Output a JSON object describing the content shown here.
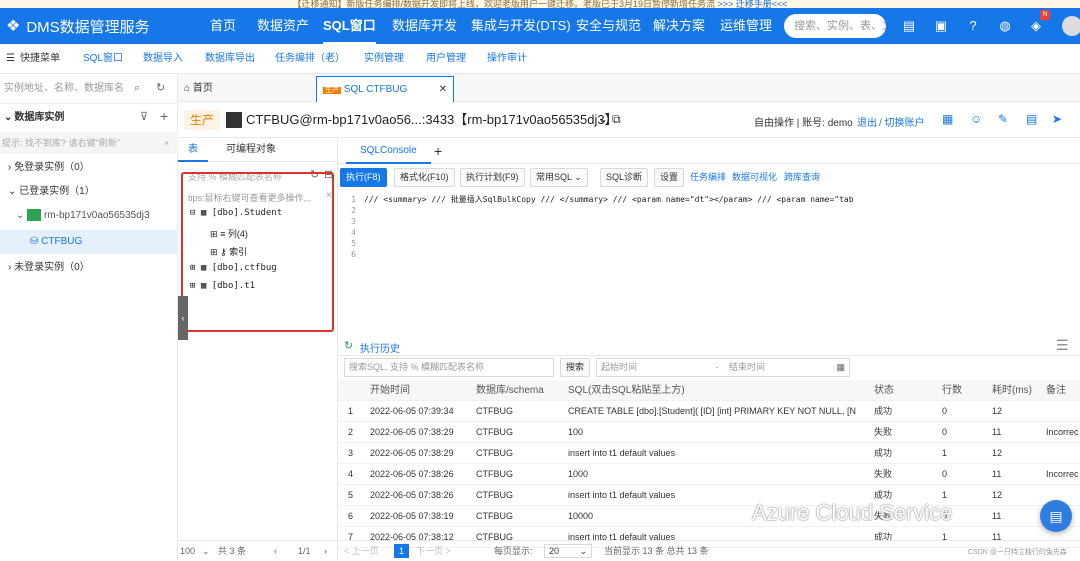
{
  "notice": {
    "text": "【迁移通知】新版任务编排/数据开发即将上线，欢迎老版用户一键迁移。老版已于3月19日暂停新增任务流",
    "link": ">>> 迁移手册<<<"
  },
  "brand": {
    "name": "DMS数据管理服务"
  },
  "topnav": {
    "items": [
      "首页",
      "数据资产",
      "SQL窗口",
      "数据库开发",
      "集成与开发(DTS)",
      "安全与规范",
      "解决方案",
      "运维管理"
    ],
    "search_placeholder": "搜索、实例、表、文",
    "badge": "N"
  },
  "subnav": {
    "items": [
      "快捷菜单",
      "SQL窗口",
      "数据导入",
      "数据库导出",
      "任务编排（老）",
      "实例管理",
      "用户管理",
      "操作审计"
    ]
  },
  "left": {
    "search_placeholder": "实例地址、名称、数据库名",
    "section": "数据库实例",
    "hint": "提示: 找不到库? 请右键\"刷新\"",
    "rows": [
      "免登录实例（0）",
      "已登录实例（1）",
      "rm-bp171v0ao56535dj3",
      "CTFBUG",
      "未登录实例（0）"
    ]
  },
  "tabs": {
    "home": "首页",
    "sql_badge": "生产",
    "sql": "SQL CTFBUG"
  },
  "header": {
    "env": "生产",
    "conn": "CTFBUG@rm-bp171v0ao56...:3433【rm-bp171v0ao56535dj3】",
    "mode": "自由操作 | 账号: demo",
    "logout": "退出",
    "switch": "/ 切换账户"
  },
  "objects": {
    "tab_table": "表",
    "tab_prog": "可编程对象",
    "filter": "支持 % 模糊匹配表名称",
    "tip": "tips:鼠标右键可查看更多操作...",
    "tree": [
      "[dbo].Student",
      "列(4)",
      "索引",
      "[dbo].ctfbug",
      "[dbo].t1"
    ],
    "page_size": "100",
    "count": "共 3 条",
    "page": "1/1"
  },
  "console": {
    "tab": "SQLConsole",
    "add": "+"
  },
  "toolbar": {
    "run": "执行(F8)",
    "format": "格式化(F10)",
    "plan": "执行计划(F9)",
    "common": "常用SQL",
    "diag": "SQL诊断",
    "settings": "设置",
    "links": [
      "任务编排",
      "数据可视化",
      "跨库查询"
    ]
  },
  "editor": {
    "lines": [
      "1",
      "2",
      "3",
      "4",
      "5",
      "6"
    ],
    "code": "/// <summary>          /// 批量插入SqlBulkCopy        /// </summary>         /// <param name=\"dt\"></param>         /// <param name=\"tab"
  },
  "history": {
    "title": "执行历史",
    "search_placeholder": "搜索SQL, 支持 % 模糊匹配表名称",
    "search_btn": "搜索",
    "start_placeholder": "起始时间",
    "sep": "-",
    "end_placeholder": "结束时间",
    "columns": [
      "",
      "开始时间",
      "数据库/schema",
      "SQL(双击SQL粘贴至上方)",
      "状态",
      "行数",
      "耗时(ms)",
      "备注"
    ],
    "rows": [
      [
        "1",
        "2022-06-05 07:39:34",
        "CTFBUG",
        "CREATE TABLE [dbo].[Student](    [ID] [int] PRIMARY KEY NOT NULL,    [N",
        "成功",
        "0",
        "12",
        ""
      ],
      [
        "2",
        "2022-06-05 07:38:29",
        "CTFBUG",
        "100",
        "失败",
        "0",
        "11",
        "Incorrec"
      ],
      [
        "3",
        "2022-06-05 07:38:29",
        "CTFBUG",
        "insert into t1 default values",
        "成功",
        "1",
        "12",
        ""
      ],
      [
        "4",
        "2022-06-05 07:38:26",
        "CTFBUG",
        "1000",
        "失败",
        "0",
        "11",
        "Incorrec"
      ],
      [
        "5",
        "2022-06-05 07:38:26",
        "CTFBUG",
        "insert into t1 default values",
        "成功",
        "1",
        "12",
        ""
      ],
      [
        "6",
        "2022-06-05 07:38:19",
        "CTFBUG",
        "10000",
        "失败",
        "0",
        "11",
        ""
      ],
      [
        "7",
        "2022-06-05 07:38:12",
        "CTFBUG",
        "insert into t1 default values",
        "成功",
        "1",
        "11",
        ""
      ]
    ],
    "prev": "< 上一页",
    "page": "1",
    "next": "下一页 >",
    "per_label": "每页显示:",
    "per": "20",
    "summary": "当前显示 13 条 总共 13 条"
  },
  "watermark": "Azure Cloud Service",
  "csdn": "CSDN @一只特立独行的兔先森",
  "colors": {
    "primary": "#1677e8",
    "env": "#f77b00",
    "red_box": "#d9362b",
    "success": "#333333"
  }
}
